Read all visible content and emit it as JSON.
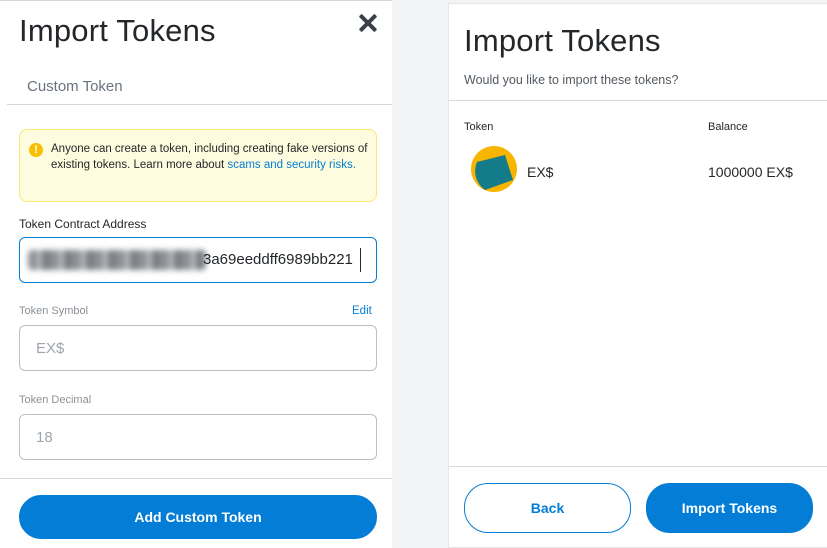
{
  "left": {
    "title": "Import Tokens",
    "tab_label": "Custom Token",
    "warning": {
      "text": "Anyone can create a token, including creating fake versions of existing tokens. Learn more about ",
      "link": "scams and security risks.",
      "icon": "info-icon"
    },
    "contract_address": {
      "label": "Token Contract Address",
      "value_visible": "3a69eeddff6989bb221"
    },
    "token_symbol": {
      "label": "Token Symbol",
      "edit_label": "Edit",
      "value": "EX$"
    },
    "token_decimal": {
      "label": "Token Decimal",
      "value": "18"
    },
    "add_button": "Add Custom Token"
  },
  "right": {
    "title": "Import Tokens",
    "subtitle": "Would you like to import these tokens?",
    "columns": {
      "token": "Token",
      "balance": "Balance"
    },
    "rows": [
      {
        "symbol": "EX$",
        "balance": "1000000 EX$"
      }
    ],
    "back_button": "Back",
    "import_button": "Import Tokens"
  },
  "colors": {
    "accent": "#037dd6",
    "warning_bg": "#fefcde",
    "warning_border": "#fbe86f",
    "icon_yellow": "#f7b500",
    "icon_teal": "#137b8a"
  }
}
